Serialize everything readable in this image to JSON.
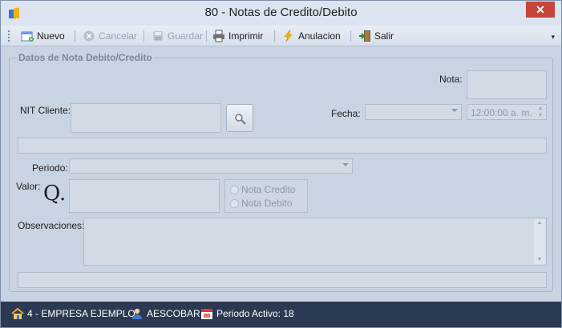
{
  "window": {
    "title": "80 - Notas de Credito/Debito",
    "close_label": "✕"
  },
  "toolbar": {
    "nuevo": "Nuevo",
    "cancelar": "Cancelar",
    "guardar": "Guardar",
    "imprimir": "Imprimir",
    "anulacion": "Anulacion",
    "salir": "Salir",
    "overflow": "▾"
  },
  "form": {
    "group_title": "Datos de Nota Debito/Credito",
    "nota_label": "Nota:",
    "nota_value": "",
    "nit_label": "NIT Cliente:",
    "nit_value": "",
    "fecha_label": "Fecha:",
    "fecha_value": "",
    "time_value": "12:00:00 a. m.",
    "cliente_name": "",
    "periodo_label": "Periodo:",
    "periodo_value": "",
    "valor_label": "Valor:",
    "currency_symbol": "Q.",
    "valor_value": "",
    "radio_credito": "Nota Credito",
    "radio_debito": "Nota Debito",
    "observaciones_label": "Observaciones:",
    "observaciones_value": "",
    "bottom_info": ""
  },
  "status": {
    "empresa": "4 - EMPRESA EJEMPLO",
    "usuario": "AESCOBAR",
    "periodo": "Periodo Activo: 18"
  },
  "icons": {
    "app": "app-logo-icon",
    "nuevo": "new-document-icon",
    "cancelar": "cancel-icon",
    "guardar": "save-disk-icon",
    "imprimir": "printer-icon",
    "anulacion": "lightning-icon",
    "salir": "exit-door-icon",
    "buscar": "search-icon",
    "empresa": "home-icon",
    "usuario": "user-icon",
    "periodo": "calendar-icon"
  },
  "colors": {
    "background": "#c9d4e3",
    "statusbar": "#2b3a52",
    "close_button": "#c7453a",
    "field": "#d2dae6"
  }
}
